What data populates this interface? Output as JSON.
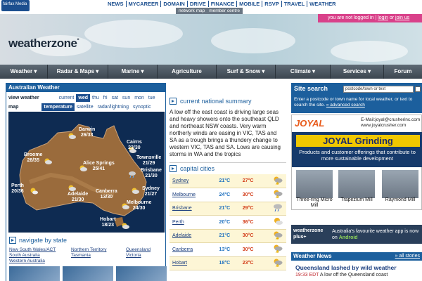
{
  "topbar": {
    "brand": "fairfax Media",
    "links": [
      "NEWS",
      "MYCAREER",
      "DOMAIN",
      "DRIVE",
      "FINANCE",
      "MOBILE",
      "RSVP",
      "TRAVEL",
      "WEATHER"
    ],
    "subtabs": [
      "network map",
      "member centre"
    ]
  },
  "header": {
    "logo_text": "weatherzone",
    "login_status": "you are not logged in",
    "login_link": "login",
    "or_text": "or",
    "join_link": "join us"
  },
  "nav": {
    "items": [
      "Weather ▾",
      "Radar & Maps ▾",
      "Marine ▾",
      "Agriculture",
      "Surf & Snow ▾",
      "Climate ▾",
      "Services ▾",
      "Forum"
    ]
  },
  "aus_panel": {
    "title": "Australian Weather",
    "view_weather_label": "view weather",
    "days": [
      "current",
      "wed",
      "thu",
      "fri",
      "sat",
      "sun",
      "mon",
      "tue"
    ],
    "selected_day": "wed",
    "map_label": "map",
    "map_types": [
      "temperature",
      "satellite",
      "radar/lightning",
      "synoptic"
    ],
    "selected_map_type": "temperature",
    "cities": [
      {
        "name": "Darwin",
        "temps": "26/33"
      },
      {
        "name": "Broome",
        "temps": "28/35"
      },
      {
        "name": "Cairns",
        "temps": "23/30"
      },
      {
        "name": "Townsville",
        "temps": "21/29"
      },
      {
        "name": "Alice Springs",
        "temps": "25/41"
      },
      {
        "name": "Brisbane",
        "temps": "21/30"
      },
      {
        "name": "Perth",
        "temps": "20/36"
      },
      {
        "name": "Sydney",
        "temps": "21/27"
      },
      {
        "name": "Adelaide",
        "temps": "21/30"
      },
      {
        "name": "Canberra",
        "temps": "13/30"
      },
      {
        "name": "Melbourne",
        "temps": "24/30"
      },
      {
        "name": "Hobart",
        "temps": "18/23"
      }
    ],
    "navigate_title": "navigate by state",
    "states": [
      "New South Wales/ACT",
      "Northern Territory",
      "Queensland",
      "South Australia",
      "Tasmania",
      "Victoria",
      "Western Australia"
    ]
  },
  "summary": {
    "title": "current national summary",
    "text": "A low off the east coast is driving large seas and heavy showers onto the southeast QLD and northeast NSW coasts. Very warm northerly winds are easing in VIC, TAS and SA as a trough brings a thundery change to western VIC, TAS and SA. Lows are causing storms in WA and the tropics"
  },
  "capitals": {
    "title": "capital cities",
    "rows": [
      {
        "city": "Sydney",
        "min": "21°C",
        "max": "27°C",
        "icon": "storm-icon"
      },
      {
        "city": "Melbourne",
        "min": "24°C",
        "max": "30°C",
        "icon": "storm-icon"
      },
      {
        "city": "Brisbane",
        "min": "21°C",
        "max": "29°C",
        "icon": "rain-icon"
      },
      {
        "city": "Perth",
        "min": "20°C",
        "max": "36°C",
        "icon": "sunny-cloud-icon"
      },
      {
        "city": "Adelaide",
        "min": "21°C",
        "max": "30°C",
        "icon": "storm-icon"
      },
      {
        "city": "Canberra",
        "min": "13°C",
        "max": "30°C",
        "icon": "storm-icon"
      },
      {
        "city": "Hobart",
        "min": "18°C",
        "max": "23°C",
        "icon": "storm-icon"
      }
    ]
  },
  "site_search": {
    "title": "Site search",
    "placeholder": "postcode/town or text",
    "description": "Enter a postcode or town name for local weather, or text to search the site.",
    "advanced_link": "» advanced search"
  },
  "ad": {
    "brand": "JOYAL",
    "email": "E-Mail:joyal@crusherinc.com",
    "website": "www.joyalcrusher.com",
    "headline": "JOYAL Grinding",
    "tagline": "Products and customer offerings that contribute to more sustainable development",
    "machines": [
      "Three-ring Micro Mill",
      "Trapezium Mill",
      "Raymond Mill"
    ]
  },
  "wz_plus": {
    "logo": "weatherzone plus+",
    "text_pre": "Australia's favourite weather app is now on",
    "android": "Android"
  },
  "news": {
    "title": "Weather News",
    "all_link": "» all stories",
    "headline": "Queensland lashed by wild weather",
    "time": "19:33 EDT",
    "teaser": "A low off the Queensland coast"
  },
  "colors": {
    "brand_blue": "#1c5f9d",
    "login_pink": "#d9418a",
    "max_red": "#d23a16",
    "min_blue": "#1c6fbf"
  }
}
